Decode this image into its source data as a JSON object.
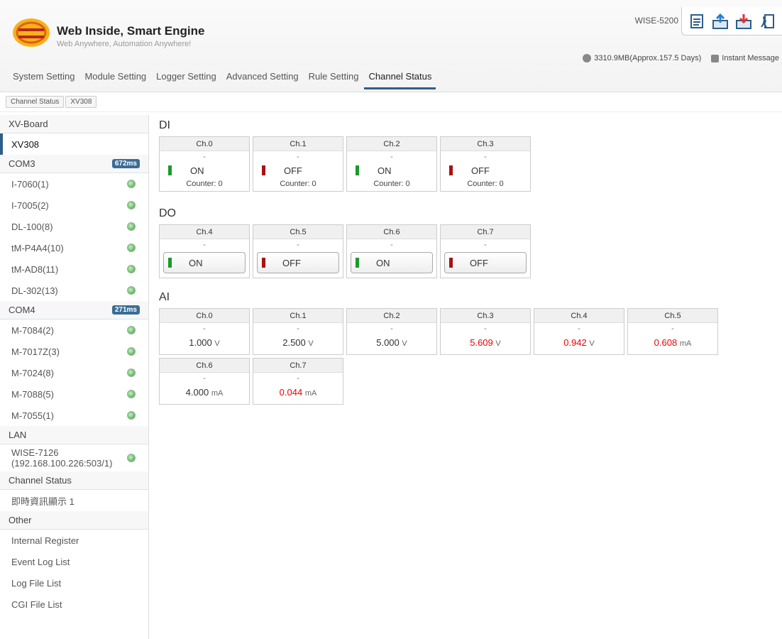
{
  "header": {
    "brand": "Web Inside, Smart Engine",
    "slogan": "Web Anywhere, Automation Anywhere!",
    "model": "WISE-5200",
    "storage": "3310.9MB(Approx.157.5 Days)",
    "instant_message": "Instant Message",
    "tools": [
      "document-icon",
      "upload-icon",
      "download-icon",
      "logout-icon"
    ]
  },
  "nav": [
    "System Setting",
    "Module Setting",
    "Logger Setting",
    "Advanced Setting",
    "Rule Setting",
    "Channel Status"
  ],
  "breadcrumb": [
    "Channel Status",
    "XV308"
  ],
  "sidebar": {
    "xvboard": "XV-Board",
    "xv308": "XV308",
    "com3": {
      "label": "COM3",
      "badge": "672ms",
      "items": [
        "I-7060(1)",
        "I-7005(2)",
        "DL-100(8)",
        "tM-P4A4(10)",
        "tM-AD8(11)",
        "DL-302(13)"
      ]
    },
    "com4": {
      "label": "COM4",
      "badge": "271ms",
      "items": [
        "M-7084(2)",
        "M-7017Z(3)",
        "M-7024(8)",
        "M-7088(5)",
        "M-7055(1)"
      ]
    },
    "lan": {
      "label": "LAN",
      "item_line1": "WISE-7126",
      "item_line2": "(192.168.100.226:503/1)"
    },
    "channel_status": {
      "label": "Channel Status",
      "item": "即時資訊顯示 1"
    },
    "other": {
      "label": "Other",
      "items": [
        "Internal Register",
        "Event Log List",
        "Log File List",
        "CGI File List"
      ]
    }
  },
  "di": {
    "title": "DI",
    "channels": [
      {
        "ch": "Ch.0",
        "desc": "-",
        "state": "ON",
        "counter": "Counter: 0"
      },
      {
        "ch": "Ch.1",
        "desc": "-",
        "state": "OFF",
        "counter": "Counter: 0"
      },
      {
        "ch": "Ch.2",
        "desc": "-",
        "state": "ON",
        "counter": "Counter: 0"
      },
      {
        "ch": "Ch.3",
        "desc": "-",
        "state": "OFF",
        "counter": "Counter: 0"
      }
    ]
  },
  "do": {
    "title": "DO",
    "channels": [
      {
        "ch": "Ch.4",
        "desc": "-",
        "state": "ON"
      },
      {
        "ch": "Ch.5",
        "desc": "-",
        "state": "OFF"
      },
      {
        "ch": "Ch.6",
        "desc": "-",
        "state": "ON"
      },
      {
        "ch": "Ch.7",
        "desc": "-",
        "state": "OFF"
      }
    ]
  },
  "ai": {
    "title": "AI",
    "channels": [
      {
        "ch": "Ch.0",
        "desc": "-",
        "value": "1.000",
        "unit": "V",
        "alarm": false
      },
      {
        "ch": "Ch.1",
        "desc": "-",
        "value": "2.500",
        "unit": "V",
        "alarm": false
      },
      {
        "ch": "Ch.2",
        "desc": "-",
        "value": "5.000",
        "unit": "V",
        "alarm": false
      },
      {
        "ch": "Ch.3",
        "desc": "-",
        "value": "5.609",
        "unit": "V",
        "alarm": true
      },
      {
        "ch": "Ch.4",
        "desc": "-",
        "value": "0.942",
        "unit": "V",
        "alarm": true
      },
      {
        "ch": "Ch.5",
        "desc": "-",
        "value": "0.608",
        "unit": "mA",
        "alarm": true
      },
      {
        "ch": "Ch.6",
        "desc": "-",
        "value": "4.000",
        "unit": "mA",
        "alarm": false
      },
      {
        "ch": "Ch.7",
        "desc": "-",
        "value": "0.044",
        "unit": "mA",
        "alarm": true
      }
    ]
  },
  "colors": {
    "on": "#1a9a2a",
    "off": "#a11",
    "alarm": "#e00",
    "accent": "#2f5d8a"
  }
}
